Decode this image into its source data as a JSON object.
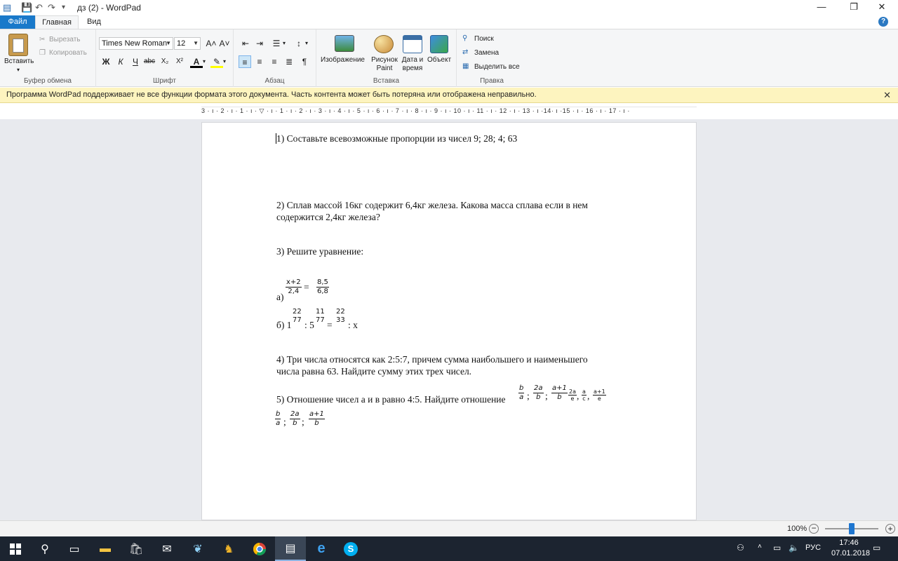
{
  "window": {
    "title": "дз (2) - WordPad"
  },
  "quick_access": {
    "save": "💾",
    "undo": "↶",
    "redo": "↷",
    "more": "▾"
  },
  "window_controls": {
    "minimize": "—",
    "maximize": "❐",
    "close": "✕"
  },
  "tabs": {
    "file": "Файл",
    "home": "Главная",
    "view": "Вид",
    "help": "?"
  },
  "ribbon": {
    "clipboard": {
      "label": "Буфер обмена",
      "paste": "Вставить",
      "cut": "Вырезать",
      "copy": "Копировать"
    },
    "font": {
      "label": "Шрифт",
      "family": "Times New Roman",
      "size": "12",
      "bold": "Ж",
      "italic": "К",
      "underline": "Ч",
      "strike": "abc",
      "subscript": "X₂",
      "superscript": "X²",
      "grow": "A˄",
      "shrink": "A˅"
    },
    "paragraph": {
      "label": "Абзац"
    },
    "insert": {
      "label": "Вставка",
      "image": "Изображение",
      "paint": "Рисунок Paint",
      "datetime": "Дата и время",
      "object": "Объект"
    },
    "editing": {
      "label": "Правка",
      "find": "Поиск",
      "replace": "Замена",
      "select_all": "Выделить все"
    }
  },
  "infobar": {
    "message": "Программа WordPad поддерживает не все функции формата этого документа. Часть контента может быть потеряна или отображена неправильно.",
    "close": "✕"
  },
  "ruler": {
    "text": "3 · ı · 2 · ı · 1 · ı · ▽ · ı · 1 · ı · 2 · ı · 3 · ı · 4 · ı · 5 · ı · 6 · ı · 7 · ı · 8 · ı · 9 · ı · 10 · ı · 11 · ı · 12 · ı · 13 · ı ·14· ı ·15 · ı · 16 · ı · 17 · ı ·"
  },
  "document": {
    "q1": "1) Составьте всевозможные пропорции из чисел 9; 28; 4; 63",
    "q2_line1": "2) Сплав массой 16кг содержит 6,4кг железа. Какова масса сплава если в нем",
    "q2_line2": "содержится 2,4кг железа?",
    "q3": "3) Решите уравнение:",
    "q3a_prefix": "а)",
    "q3a_f1_num": "x+2",
    "q3a_f1_den": "2,4",
    "q3a_eq": "=",
    "q3a_f2_num": "8,5",
    "q3a_f2_den": "6,8",
    "q3b_prefix": "б) 1",
    "q3b_f1_num": "22",
    "q3b_f1_den": "77",
    "q3b_mid": ": 5",
    "q3b_f2_num": "11",
    "q3b_f2_den": "77",
    "q3b_eq": "=",
    "q3b_f3_num": "22",
    "q3b_f3_den": "33",
    "q3b_suffix": ": x",
    "q4_line1": "4) Три числа относятся как 2:5:7, причем сумма наибольшего и наименьшего",
    "q4_line2": "числа равна 63. Найдите сумму этих трех чисел.",
    "q5": "5) Отношение чисел а и в равно 4:5. Найдите отношение",
    "q5_fracs": [
      {
        "num": "b",
        "den": "a"
      },
      {
        "num": "2a",
        "den": "b"
      },
      {
        "num": "a+1",
        "den": "b"
      }
    ],
    "q5_small_fracs": [
      {
        "num": "2a",
        "den": "e"
      },
      {
        "num": "a",
        "den": "c"
      },
      {
        "num": "a+1",
        "den": "e"
      }
    ],
    "q5_sep": ";",
    "q5_comma": ","
  },
  "status": {
    "zoom": "100%",
    "minus": "−",
    "plus": "+"
  },
  "taskbar": {
    "tray_lang": "РУС",
    "time": "17:46",
    "date": "07.01.2018"
  }
}
